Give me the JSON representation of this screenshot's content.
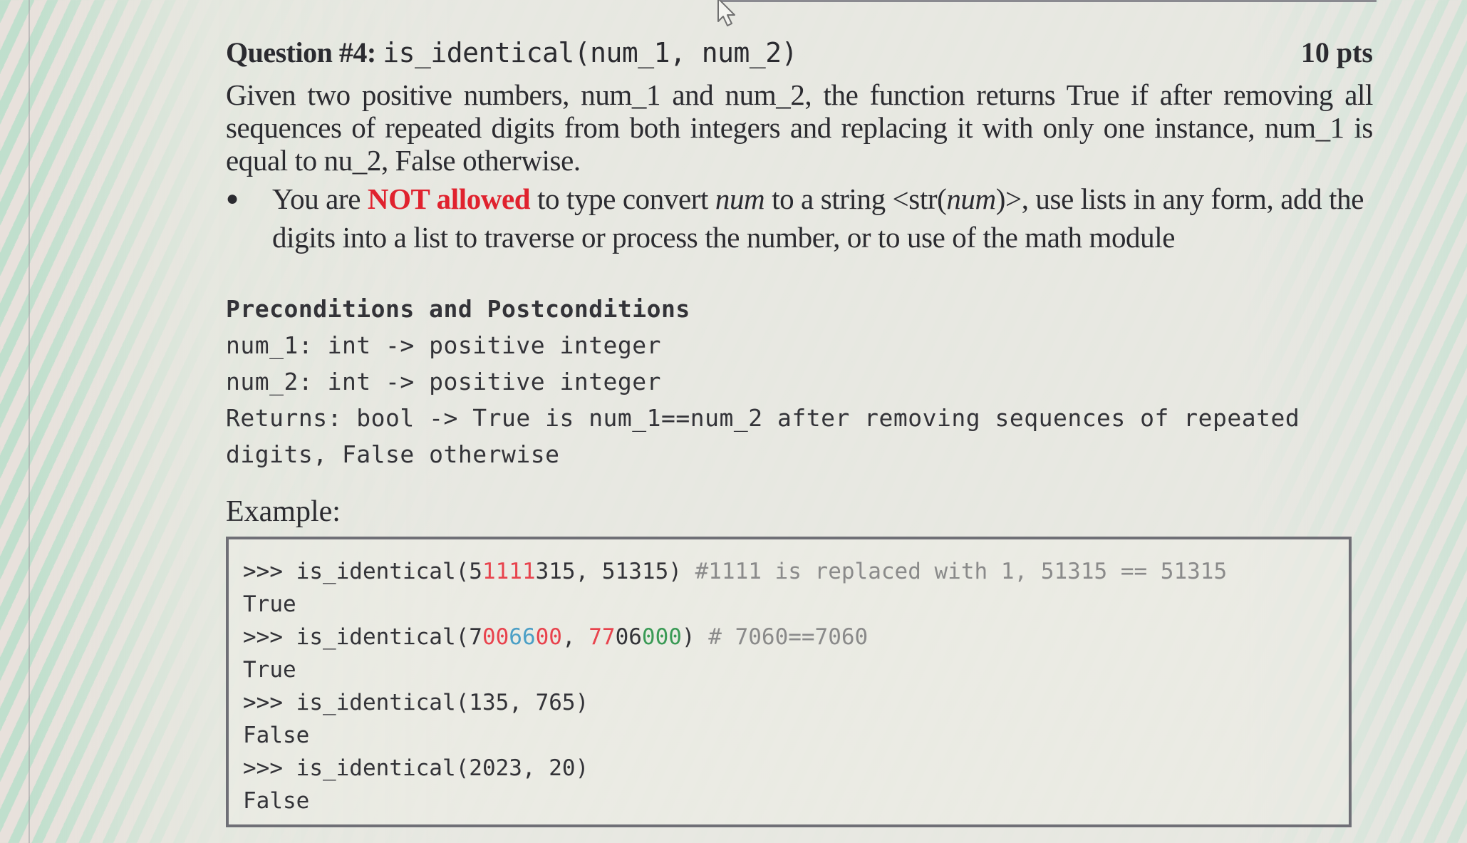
{
  "question": {
    "label": "Question #4:",
    "signature": "is_identical(num_1, num_2)",
    "points": "10 pts",
    "description": "Given two positive numbers, num_1 and num_2, the function returns True if after removing all sequences of repeated digits from both integers and replacing it with only one instance, num_1 is equal to nu_2, False otherwise.",
    "bullet": {
      "part1": "You are ",
      "emphasis": "NOT allowed",
      "part2": " to type convert ",
      "italic1": "num",
      "part3": " to a string <str(",
      "italic2": "num",
      "part4": ")>, use lists in any form, add the digits into a list to traverse or process the number, or to use of the math module"
    }
  },
  "spec": {
    "heading": "Preconditions and Postconditions",
    "lines": [
      "num_1: int -> positive integer",
      "num_2: int -> positive integer",
      "Returns: bool -> True is num_1==num_2 after removing sequences of repeated",
      "digits, False otherwise"
    ]
  },
  "example": {
    "label": "Example:",
    "lines": [
      {
        "segments": [
          {
            "text": ">>> is_identical(5",
            "color": "default"
          },
          {
            "text": "1111",
            "color": "red"
          },
          {
            "text": "315, 51315) ",
            "color": "default"
          },
          {
            "text": "#1111 is replaced with 1, 51315 == 51315",
            "color": "comment"
          }
        ]
      },
      {
        "segments": [
          {
            "text": "True",
            "color": "default"
          }
        ]
      },
      {
        "segments": [
          {
            "text": ">>> is_identical(7",
            "color": "default"
          },
          {
            "text": "00",
            "color": "red"
          },
          {
            "text": "66",
            "color": "blue"
          },
          {
            "text": "00",
            "color": "red"
          },
          {
            "text": ", ",
            "color": "default"
          },
          {
            "text": "77",
            "color": "red"
          },
          {
            "text": "06",
            "color": "default"
          },
          {
            "text": "000",
            "color": "green"
          },
          {
            "text": ") ",
            "color": "default"
          },
          {
            "text": "# 7060==7060",
            "color": "comment"
          }
        ]
      },
      {
        "segments": [
          {
            "text": "True",
            "color": "default"
          }
        ]
      },
      {
        "segments": [
          {
            "text": ">>> is_identical(135, 765)",
            "color": "default"
          }
        ]
      },
      {
        "segments": [
          {
            "text": "False",
            "color": "default"
          }
        ]
      },
      {
        "segments": [
          {
            "text": ">>> is_identical(2023, 20)",
            "color": "default"
          }
        ]
      },
      {
        "segments": [
          {
            "text": "False",
            "color": "default"
          }
        ]
      }
    ]
  },
  "colors": {
    "emphasis_red": "#e0222e",
    "code_red": "#e8434d",
    "code_blue": "#4b9fc6",
    "code_green": "#3a9a55",
    "code_comment": "#8a8a8a"
  }
}
